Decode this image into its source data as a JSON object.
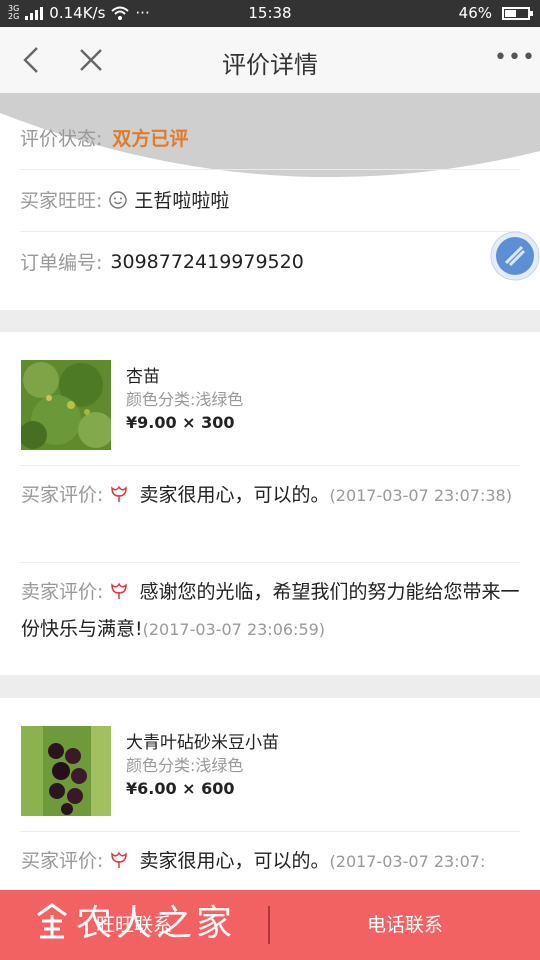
{
  "status_bar": {
    "network_top": "3G",
    "network_bottom": "2G",
    "speed": "0.14K/s",
    "time": "15:38",
    "battery": "46%",
    "battery_level": 0.46
  },
  "nav": {
    "title": "评价详情",
    "more": "•••"
  },
  "info": {
    "status_label": "评价状态:",
    "status_value": "双方已评",
    "buyer_label": "买家旺旺:",
    "buyer_value": "王哲啦啦啦",
    "order_label": "订单编号:",
    "order_value": "3098772419979520"
  },
  "products": [
    {
      "name": "杏苗",
      "spec": "颜色分类:浅绿色",
      "price": "¥9.00 × 300",
      "buyer_review_label": "买家评价:",
      "buyer_review_text": "卖家很用心，可以的。",
      "buyer_review_time": "(2017-03-07 23:07:38)",
      "seller_review_label": "卖家评价:",
      "seller_review_text": "感谢您的光临，希望我们的努力能给您带来一份快乐与满意!",
      "seller_review_time": "(2017-03-07 23:06:59)"
    },
    {
      "name": "大青叶砧砂米豆小苗",
      "spec": "颜色分类:浅绿色",
      "price": "¥6.00 × 600",
      "buyer_review_label": "买家评价:",
      "buyer_review_text": "卖家很用心，可以的。",
      "buyer_review_time": "(2017-03-07 23:07:"
    }
  ],
  "bottom": {
    "contact_wangwang": "旺旺联系",
    "contact_phone": "电话联系",
    "watermark": "农人之家"
  },
  "colors": {
    "accent_orange": "#e07a2c",
    "bottom_bar": "#f36263",
    "flower_icon": "#e0393c"
  }
}
